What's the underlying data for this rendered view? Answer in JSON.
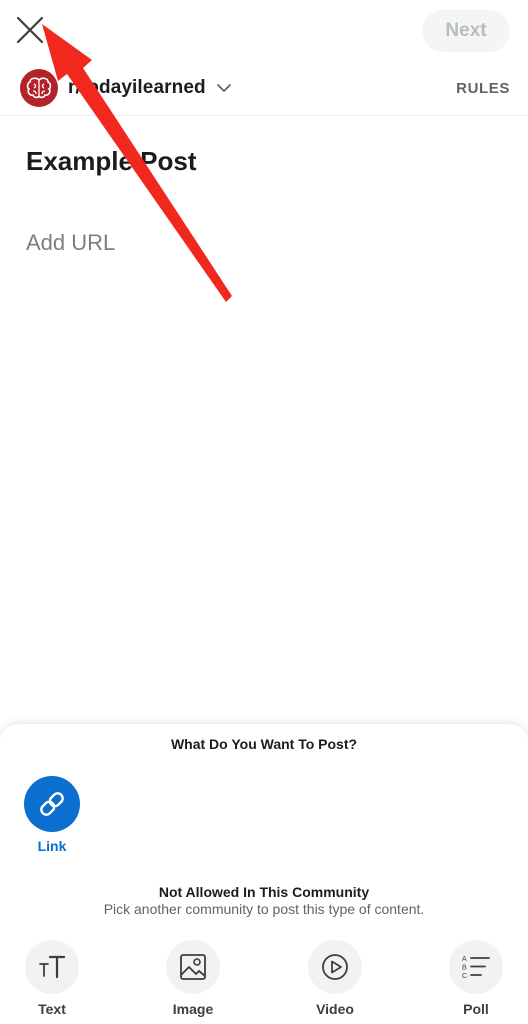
{
  "header": {
    "next_label": "Next"
  },
  "community": {
    "name": "r/todayilearned",
    "rules_label": "RULES"
  },
  "post": {
    "title": "Example Post",
    "url_placeholder": "Add URL"
  },
  "sheet": {
    "title": "What Do You Want To Post?",
    "selected_option": {
      "label": "Link",
      "icon": "link-icon"
    },
    "not_allowed_title": "Not Allowed In This Community",
    "not_allowed_subtitle": "Pick another community to post this type of content.",
    "options": [
      {
        "label": "Text",
        "icon": "text-icon"
      },
      {
        "label": "Image",
        "icon": "image-icon"
      },
      {
        "label": "Video",
        "icon": "video-icon"
      },
      {
        "label": "Poll",
        "icon": "poll-icon"
      }
    ]
  },
  "colors": {
    "accent_blue": "#0a6fcf",
    "annotation_arrow": "#f0281e",
    "community_avatar": "#b3232a",
    "disabled_text": "#b9bcbf"
  }
}
